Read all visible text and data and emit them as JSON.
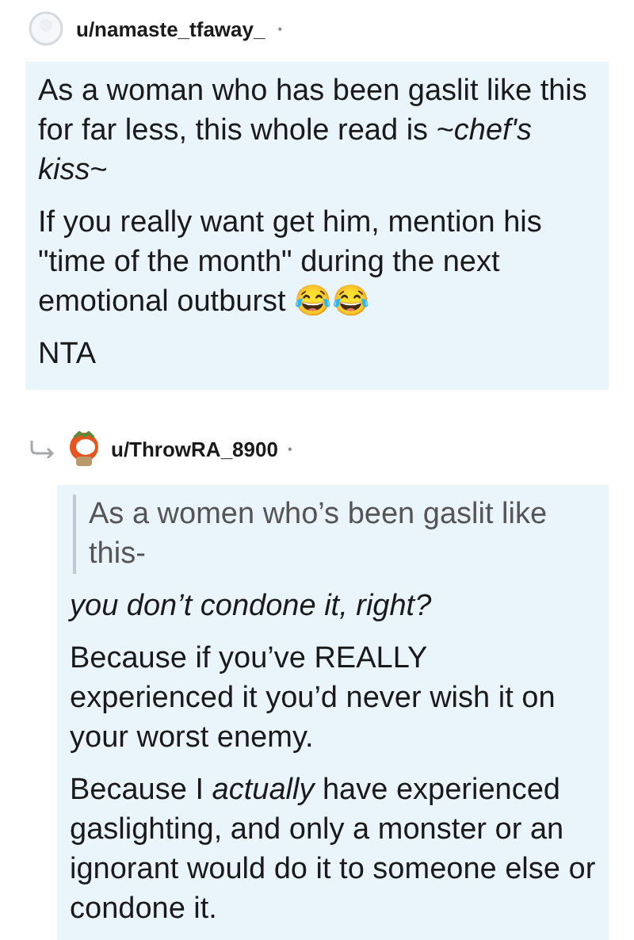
{
  "comments": [
    {
      "username": "u/namaste_tfaway_",
      "separator": "•",
      "kind": "top",
      "blocks": [
        {
          "kind": "paragraph",
          "text": "As a woman who has been gaslit like this for far less, this whole read is ~*chef's kiss*~"
        },
        {
          "kind": "paragraph",
          "text": "If you really want get him, mention his \"time of the month\" during the next emotional outburst 😂😂"
        },
        {
          "kind": "paragraph",
          "text": "NTA"
        }
      ]
    },
    {
      "username": "u/ThrowRA_8900",
      "separator": "•",
      "kind": "reply",
      "blocks": [
        {
          "kind": "quote",
          "text": "As a women who’s been gaslit like this-"
        },
        {
          "kind": "paragraph",
          "text": "*you don’t condone it, right?*"
        },
        {
          "kind": "paragraph",
          "text": "Because if you’ve REALLY experienced it you’d never wish it on your worst enemy."
        },
        {
          "kind": "paragraph",
          "text": "Because I *actually* have experienced gaslighting, and only a monster or an ignorant would do it to someone else or condone it."
        }
      ]
    }
  ]
}
